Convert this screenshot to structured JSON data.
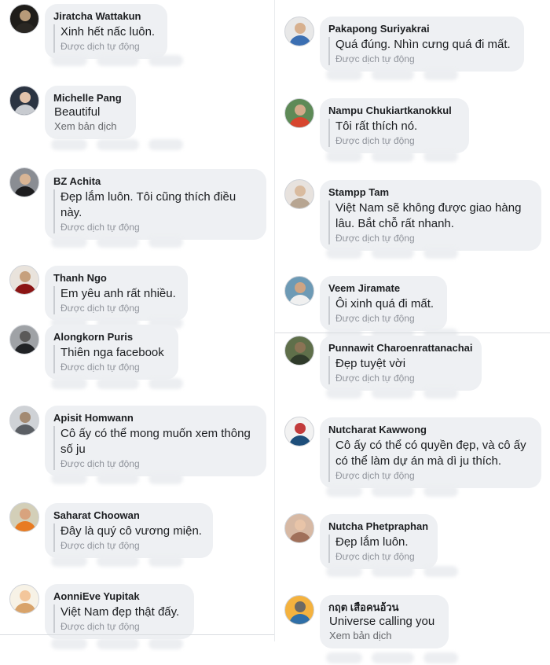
{
  "left_column": [
    {
      "name": "Jiratcha Wattakun",
      "text": "Xinh hết nấc luôn.",
      "note": "Được dịch tự động",
      "avatar": {
        "bg": "#1f1d1a",
        "skin": "#b79a79",
        "cloth": "#2a2723"
      }
    },
    {
      "name": "Michelle Pang",
      "text": "Beautiful",
      "note": "Xem bản dịch",
      "avatar": {
        "bg": "#2b3442",
        "skin": "#e3c3ab",
        "cloth": "#c8cbd0"
      }
    },
    {
      "name": "BZ Achita",
      "text": "Đẹp lắm luôn. Tôi cũng thích điều này.",
      "note": "Được dịch tự động",
      "avatar": {
        "bg": "#8a8d93",
        "skin": "#d9b595",
        "cloth": "#1d1d1f"
      }
    },
    {
      "name": "Thanh Ngo",
      "text": "Em yêu anh rất nhiều.",
      "note": "Được dịch tự động",
      "avatar": {
        "bg": "#e9e3dc",
        "skin": "#c6a07d",
        "cloth": "#8b1414"
      }
    },
    {
      "name": "Alongkorn Puris",
      "text": "Thiên nga facebook",
      "note": "Được dịch tự động",
      "avatar": {
        "bg": "#9fa2a6",
        "skin": "#5b5a59",
        "cloth": "#202225"
      }
    },
    {
      "name": "Apisit Homwann",
      "text": "Cô ấy có thể mong muốn xem thông số ju",
      "note": "Được dịch tự động",
      "avatar": {
        "bg": "#cfd2d6",
        "skin": "#a38a72",
        "cloth": "#5b5f64"
      }
    },
    {
      "name": "Saharat Choowan",
      "text": "Đây là quý cô vương miện.",
      "note": "Được dịch tự động",
      "avatar": {
        "bg": "#d3cfb8",
        "skin": "#d8a37e",
        "cloth": "#e87b22"
      }
    },
    {
      "name": "AonniEve Yupitak",
      "text": "Việt Nam đẹp thật đấy.",
      "note": "Được dịch tự động",
      "avatar": {
        "bg": "#f7f2e6",
        "skin": "#f3c69b",
        "cloth": "#d8a36a"
      }
    }
  ],
  "right_column": [
    {
      "name": "Pakapong Suriyakrai",
      "text": "Quá đúng. Nhìn cưng quá đi mất.",
      "note": "Được dịch tự động",
      "avatar": {
        "bg": "#e8e8e8",
        "skin": "#d7b08e",
        "cloth": "#3b6fb2"
      }
    },
    {
      "name": "Nampu Chukiartkanokkul",
      "text": "Tôi rất thích nó.",
      "note": "Được dịch tự động",
      "avatar": {
        "bg": "#5e8a57",
        "skin": "#d3aa8a",
        "cloth": "#d7452e"
      }
    },
    {
      "name": "Stampp Tam",
      "text": "Việt Nam sẽ không được giao hàng lâu. Bắt chỗ rất nhanh.",
      "note": "Được dịch tự động",
      "avatar": {
        "bg": "#e7e2de",
        "skin": "#d9bb9f",
        "cloth": "#b7a592"
      }
    },
    {
      "name": "Veem Jiramate",
      "text": "Ôi xinh quá đi mất.",
      "note": "Được dịch tự động",
      "avatar": {
        "bg": "#6d9ab5",
        "skin": "#cfa483",
        "cloth": "#f0f0f0"
      }
    },
    {
      "name": "Punnawit Charoenrattanachai",
      "text": "Đẹp tuyệt vời",
      "note": "Được dịch tự động",
      "avatar": {
        "bg": "#5f6f4a",
        "skin": "#8b7355",
        "cloth": "#2f3a2a"
      }
    },
    {
      "name": "Nutcharat Kawwong",
      "text": "Cô ấy có thể có quyền đẹp, và cô ấy có thể làm dự án mà dì ju thích.",
      "note": "Được dịch tự động",
      "avatar": {
        "bg": "#f2f2f2",
        "skin": "#c23b3b",
        "cloth": "#1d4e7a"
      }
    },
    {
      "name": "Nutcha Phetpraphan",
      "text": "Đẹp lắm luôn.",
      "note": "Được dịch tự động",
      "avatar": {
        "bg": "#d7b9a4",
        "skin": "#e8c4a8",
        "cloth": "#a0705a"
      }
    },
    {
      "name": "กฤต เสือคนอ้วน",
      "text": "Universe calling you",
      "note": "Xem bản dịch",
      "avatar": {
        "bg": "#f4b23e",
        "skin": "#6d6a64",
        "cloth": "#2f6fa8"
      }
    }
  ]
}
